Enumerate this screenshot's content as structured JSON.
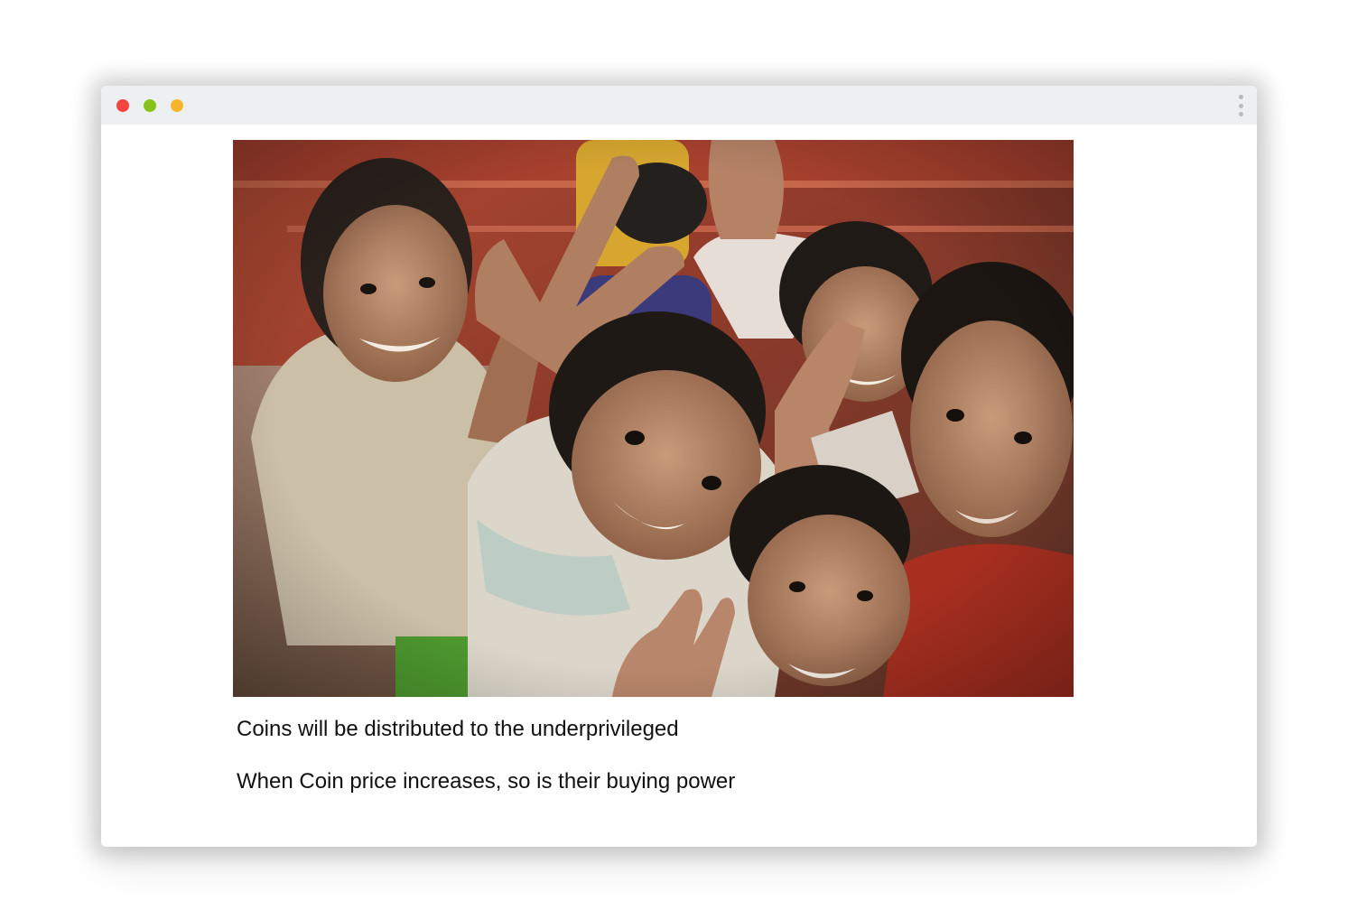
{
  "window": {
    "controls": {
      "close_color": "#f3443f",
      "zoom_color": "#86c31a",
      "minimize_color": "#f6b62c"
    },
    "menu_icon": "vertical-ellipsis-icon"
  },
  "hero_photo": {
    "subject": "group-of-smiling-children-photo"
  },
  "captions": {
    "line1": "Coins will be distributed to the underprivileged",
    "line2": "When Coin price increases, so is their buying power"
  }
}
